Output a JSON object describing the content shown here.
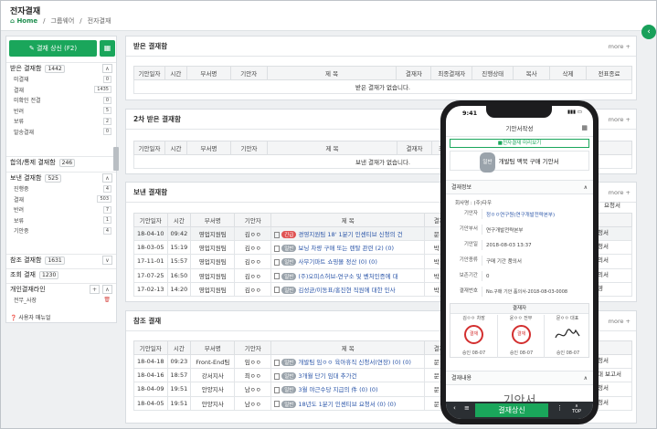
{
  "header": {
    "title": "전자결재",
    "breadcrumb": [
      "Home",
      "그룹웨어",
      "전자결재"
    ],
    "home_icon": "home-icon"
  },
  "sidebar": {
    "approve_button": "결재 상신 (F2)",
    "groups": [
      {
        "label": "받은 결재함",
        "count": "1442",
        "items": [
          {
            "label": "미결재",
            "n": "0"
          },
          {
            "label": "결재",
            "n": "1435"
          },
          {
            "label": "미확인 전결",
            "n": "0"
          },
          {
            "label": "반려",
            "n": "5"
          },
          {
            "label": "보류",
            "n": "2"
          },
          {
            "label": "발송결재",
            "n": "0"
          }
        ]
      },
      {
        "label": "합의/통제 결재함",
        "count": "246",
        "items": []
      },
      {
        "label": "보낸 결재함",
        "count": "525",
        "items": [
          {
            "label": "진행중",
            "n": "4"
          },
          {
            "label": "결재",
            "n": "503"
          },
          {
            "label": "반려",
            "n": "7"
          },
          {
            "label": "보류",
            "n": "1"
          },
          {
            "label": "기안중",
            "n": "4"
          }
        ]
      },
      {
        "label": "참조 결재함",
        "count": "1631",
        "items": []
      },
      {
        "label": "조회 결재",
        "count": "1230",
        "items": []
      },
      {
        "label": "개인결재라인",
        "count": "",
        "items": [
          {
            "label": "전무_사장",
            "n": ""
          }
        ]
      }
    ],
    "manual": "사용자 매뉴얼"
  },
  "more_label": "more +",
  "panels": [
    {
      "title": "받은 결재함",
      "headers": [
        "기안일자",
        "시간",
        "부서명",
        "기안자",
        "제 목",
        "결재자",
        "최종결재자",
        "진행상태",
        "복사",
        "삭제",
        "전표종료"
      ],
      "empty": "받은 결재가 없습니다."
    },
    {
      "title": "2차 받은 결재함",
      "headers": [
        "기안일자",
        "시간",
        "부서명",
        "기안자",
        "제 목",
        "결재자",
        "최종결재자",
        "진행상태"
      ],
      "empty": "보낸 결재가 없습니다."
    },
    {
      "title": "보낸 결재함",
      "headers": [
        "기안일자",
        "시간",
        "부서명",
        "기안자",
        "제 목",
        "결재자"
      ],
      "rows": [
        [
          "18-04-10",
          "09:42",
          "영업지원팀",
          "김ㅇㅇ",
          "긴급",
          "경영지원팀 18' 1분기 인센티브 신청의 건",
          "문ㅇㅇ"
        ],
        [
          "18-03-05",
          "15:19",
          "영업지원팀",
          "김ㅇㅇ",
          "일반",
          "보닝 차량 구매 또는 렌탈 관련 (2) (0)",
          "박ㅇㅇ"
        ],
        [
          "17-11-01",
          "15:57",
          "영업지원팀",
          "김ㅇㅇ",
          "일반",
          "사무기마트 쇼핑몰 정산 (0) (0)",
          "박ㅇㅇ"
        ],
        [
          "17-07-25",
          "16:50",
          "영업지원팀",
          "김ㅇㅇ",
          "일반",
          "(주)오피스허브-연구소 및 벤처인증에 대",
          "박ㅇㅇ"
        ],
        [
          "17-02-13",
          "14:20",
          "영업지원팀",
          "김ㅇㅇ",
          "일반",
          "김성균/이동표/홍진현 직원에 대한 인사",
          "박ㅇㅇ"
        ]
      ]
    },
    {
      "title": "참조 결재",
      "headers": [
        "기안일자",
        "시간",
        "부서명",
        "기안자",
        "제 목",
        "결재자"
      ],
      "rows": [
        [
          "18-04-18",
          "09:23",
          "Front-End팀",
          "임ㅇㅇ",
          "일반",
          "개발팀 임ㅇㅇ 육아휴직 신청서(연장) (0) (0)",
          "문ㅇㅇ"
        ],
        [
          "18-04-16",
          "18:57",
          "강서지사",
          "최ㅇㅇ",
          "일반",
          "3개월 단기 임대 추가건",
          "문ㅇㅇ"
        ],
        [
          "18-04-09",
          "19:51",
          "안양지사",
          "남ㅇㅇ",
          "일반",
          "3월 야근수당 지급의 件 (0) (0)",
          "문ㅇㅇ"
        ],
        [
          "18-04-05",
          "19:51",
          "안양지사",
          "남ㅇㅇ",
          "일반",
          "18년도 1분기 인센티브 요청서 (0) (0)",
          "문ㅇㅇ"
        ]
      ]
    }
  ],
  "right_fragments": [
    "요청서",
    "요청서",
    "요청서",
    "품의서",
    "품의서",
    "경영",
    "요청서",
    "임대 보고서",
    "요청서",
    "요청서"
  ],
  "phone": {
    "time": "9:41",
    "header": "기안서작성",
    "preview_link": "■전자결재 미리보기",
    "badge": "일반",
    "doc_title": "개발팀 맥북 구매 기안서",
    "info_section": "결재정보",
    "drafter_line": "회사명 : (주)다우",
    "fields": [
      {
        "k": "기안자",
        "v": "정ㅇㅇ연구원(연구개발전략본부)"
      },
      {
        "k": "기안부서",
        "v": "연구개발전략본부"
      },
      {
        "k": "기안일",
        "v": "2018-08-03 13:37"
      },
      {
        "k": "기안종류",
        "v": "구매 기간 품의서"
      },
      {
        "k": "보존기간",
        "v": "0"
      },
      {
        "k": "결재번호",
        "v": "No.구매 기안 품의서-2018-08-03-0008"
      }
    ],
    "approvers_title": "결재자",
    "approvers": [
      {
        "name": "김ㅇㅇ 차장",
        "date": "승인 08-07",
        "stamp": "결재"
      },
      {
        "name": "윤ㅇㅇ 전무",
        "date": "승인 08-07",
        "stamp": "결재"
      },
      {
        "name": "문ㅇㅇ 대표",
        "date": "승인 08-07",
        "stamp": ""
      }
    ],
    "content_section": "결재내용",
    "content_title": "기안서",
    "submit": "결재상신",
    "top": "TOP"
  }
}
